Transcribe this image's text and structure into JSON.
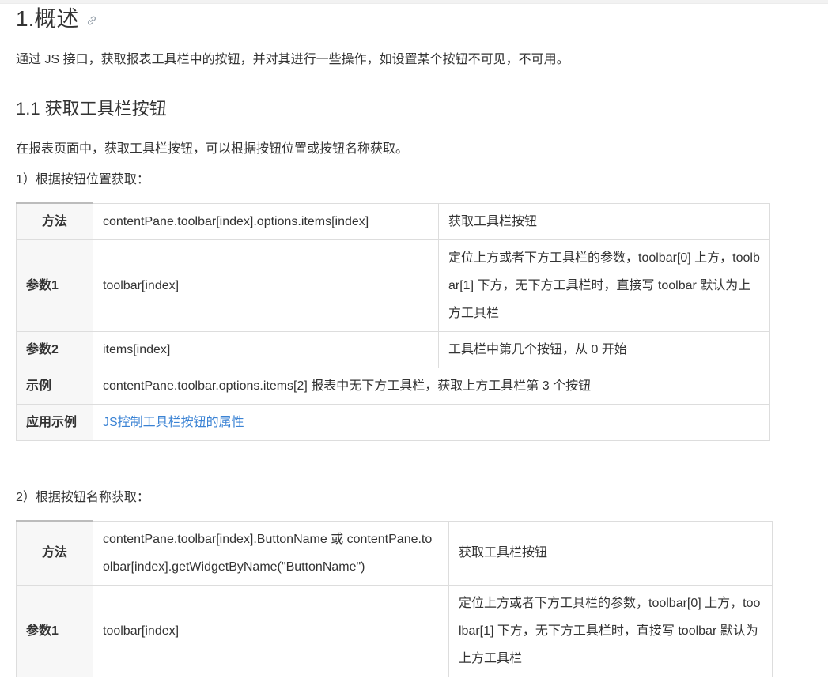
{
  "heading1": "1.概述",
  "intro": "通过 JS 接口，获取报表工具栏中的按钮，并对其进行一些操作，如设置某个按钮不可见，不可用。",
  "heading2": "1.1 获取工具栏按钮",
  "para1": "在报表页面中，获取工具栏按钮，可以根据按钮位置或按钮名称获取。",
  "sub1": "1）根据按钮位置获取：",
  "table1": {
    "method_label": "方法",
    "method_code": "contentPane.toolbar[index].options.items[index]",
    "method_desc": "获取工具栏按钮",
    "param1_label": "参数1",
    "param1_code": "toolbar[index]",
    "param1_desc": "定位上方或者下方工具栏的参数，toolbar[0] 上方，toolbar[1] 下方，无下方工具栏时，直接写 toolbar 默认为上方工具栏",
    "param2_label": "参数2",
    "param2_code": "items[index]",
    "param2_desc": "工具栏中第几个按钮，从 0 开始",
    "example_label": "示例",
    "example_text": "contentPane.toolbar.options.items[2] 报表中无下方工具栏，获取上方工具栏第 3 个按钮",
    "app_label": "应用示例",
    "app_link": "JS控制工具栏按钮的属性"
  },
  "sub2": "2）根据按钮名称获取：",
  "table2": {
    "method_label": "方法",
    "method_code": "contentPane.toolbar[index].ButtonName  或 contentPane.toolbar[index].getWidgetByName(\"ButtonName\")",
    "method_desc": "获取工具栏按钮",
    "param1_label": "参数1",
    "param1_code": "toolbar[index]",
    "param1_desc": "定位上方或者下方工具栏的参数，toolbar[0] 上方，toolbar[1] 下方，无下方工具栏时，直接写 toolbar 默认为上方工具栏"
  },
  "icons": {
    "anchor": "link-icon"
  }
}
